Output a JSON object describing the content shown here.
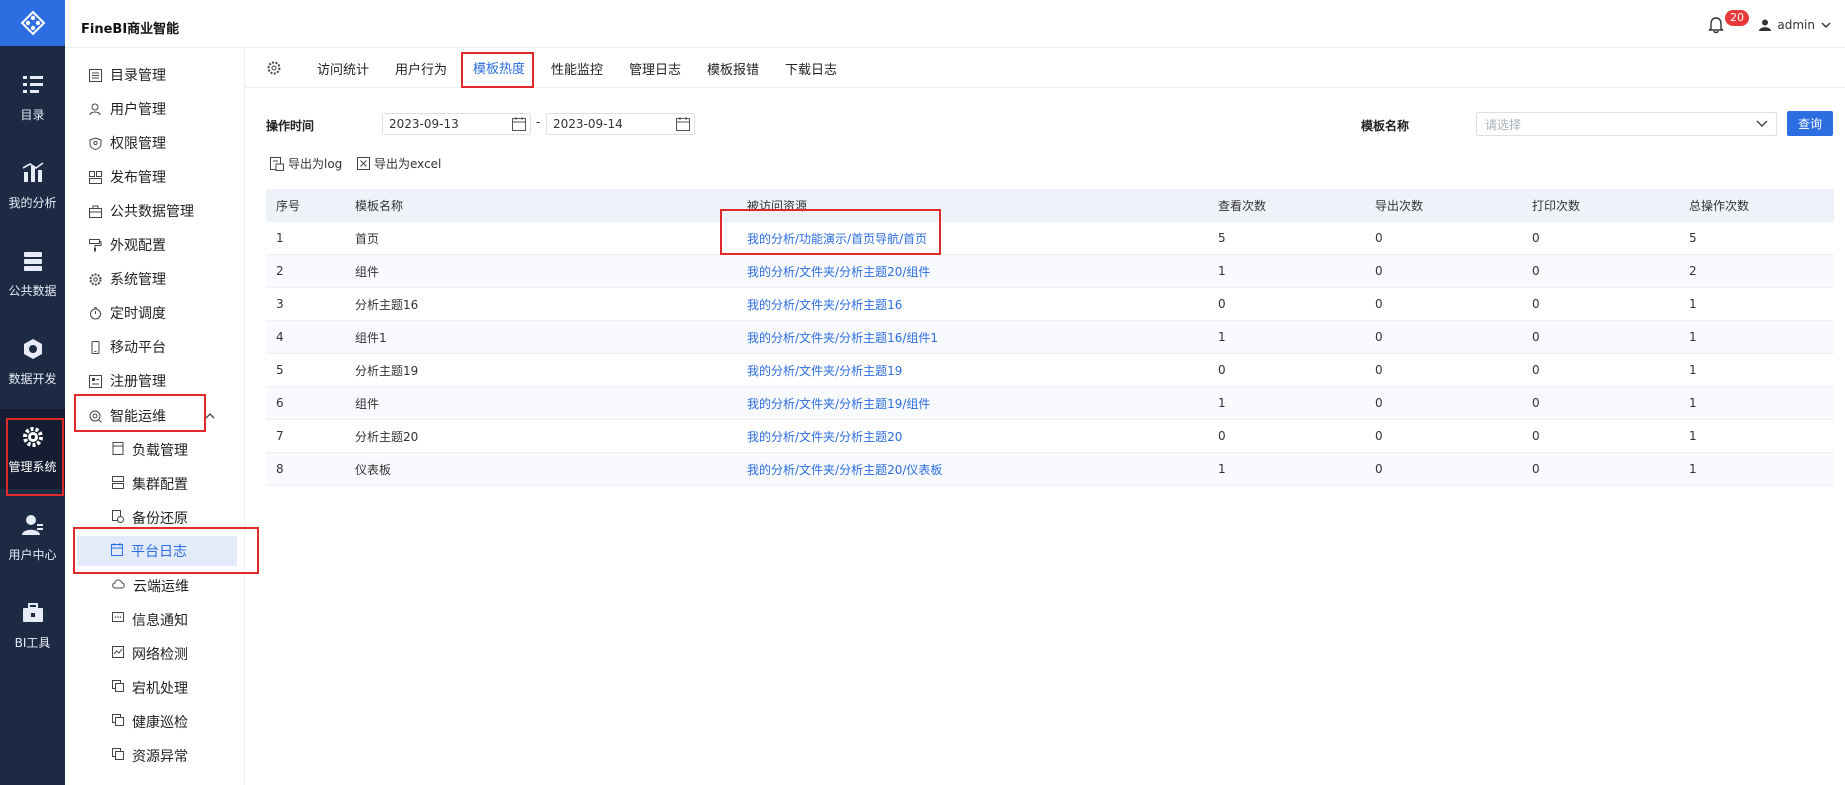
{
  "app": {
    "title": "FineBI商业智能"
  },
  "rail": [
    {
      "label": "目录",
      "icon": "catalog-icon"
    },
    {
      "label": "我的分析",
      "icon": "chart-icon"
    },
    {
      "label": "公共数据",
      "icon": "database-icon"
    },
    {
      "label": "数据开发",
      "icon": "hexagon-icon"
    },
    {
      "label": "管理系统",
      "icon": "gear-icon"
    },
    {
      "label": "用户中心",
      "icon": "user-icon"
    },
    {
      "label": "BI工具",
      "icon": "toolbox-icon"
    }
  ],
  "header": {
    "notifications": "20",
    "user": "admin"
  },
  "sidenav": {
    "items": [
      {
        "label": "目录管理",
        "icon": "list-icon"
      },
      {
        "label": "用户管理",
        "icon": "user-icon"
      },
      {
        "label": "权限管理",
        "icon": "shield-icon"
      },
      {
        "label": "发布管理",
        "icon": "publish-icon"
      },
      {
        "label": "公共数据管理",
        "icon": "briefcase-icon"
      },
      {
        "label": "外观配置",
        "icon": "paint-roller-icon"
      },
      {
        "label": "系统管理",
        "icon": "gear-icon"
      },
      {
        "label": "定时调度",
        "icon": "timer-icon"
      },
      {
        "label": "移动平台",
        "icon": "mobile-icon"
      },
      {
        "label": "注册管理",
        "icon": "register-icon"
      },
      {
        "label": "智能运维",
        "icon": "ops-icon"
      }
    ],
    "subitems": [
      {
        "label": "负载管理",
        "icon": "document-icon"
      },
      {
        "label": "集群配置",
        "icon": "server-icon"
      },
      {
        "label": "备份还原",
        "icon": "backup-icon"
      },
      {
        "label": "平台日志",
        "icon": "calendar-icon"
      },
      {
        "label": "云端运维",
        "icon": "cloud-icon"
      },
      {
        "label": "信息通知",
        "icon": "message-icon"
      },
      {
        "label": "网络检测",
        "icon": "network-icon"
      },
      {
        "label": "宕机处理",
        "icon": "copy-icon"
      },
      {
        "label": "健康巡检",
        "icon": "copy-icon"
      },
      {
        "label": "资源异常",
        "icon": "copy-icon"
      }
    ]
  },
  "tabs": [
    "访问统计",
    "用户行为",
    "模板热度",
    "性能监控",
    "管理日志",
    "模板报错",
    "下载日志"
  ],
  "filters": {
    "time_label": "操作时间",
    "date_start": "2023-09-13",
    "date_end": "2023-09-14",
    "separator": "-",
    "template_label": "模板名称",
    "template_placeholder": "请选择",
    "query": "查询"
  },
  "exports": {
    "log": "导出为log",
    "excel": "导出为excel"
  },
  "table": {
    "headers": [
      "序号",
      "模板名称",
      "被访问资源",
      "查看次数",
      "导出次数",
      "打印次数",
      "总操作次数"
    ],
    "rows": [
      [
        "1",
        "首页",
        "我的分析/功能演示/首页导航/首页",
        "5",
        "0",
        "0",
        "5"
      ],
      [
        "2",
        "组件",
        "我的分析/文件夹/分析主题20/组件",
        "1",
        "0",
        "0",
        "2"
      ],
      [
        "3",
        "分析主题16",
        "我的分析/文件夹/分析主题16",
        "0",
        "0",
        "0",
        "1"
      ],
      [
        "4",
        "组件1",
        "我的分析/文件夹/分析主题16/组件1",
        "1",
        "0",
        "0",
        "1"
      ],
      [
        "5",
        "分析主题19",
        "我的分析/文件夹/分析主题19",
        "0",
        "0",
        "0",
        "1"
      ],
      [
        "6",
        "组件",
        "我的分析/文件夹/分析主题19/组件",
        "1",
        "0",
        "0",
        "1"
      ],
      [
        "7",
        "分析主题20",
        "我的分析/文件夹/分析主题20",
        "0",
        "0",
        "0",
        "1"
      ],
      [
        "8",
        "仪表板",
        "我的分析/文件夹/分析主题20/仪表板",
        "1",
        "0",
        "0",
        "1"
      ]
    ]
  },
  "colors": {
    "accent": "#2c6de1",
    "rail": "#1d2a44",
    "annotation": "#e02a2a"
  }
}
